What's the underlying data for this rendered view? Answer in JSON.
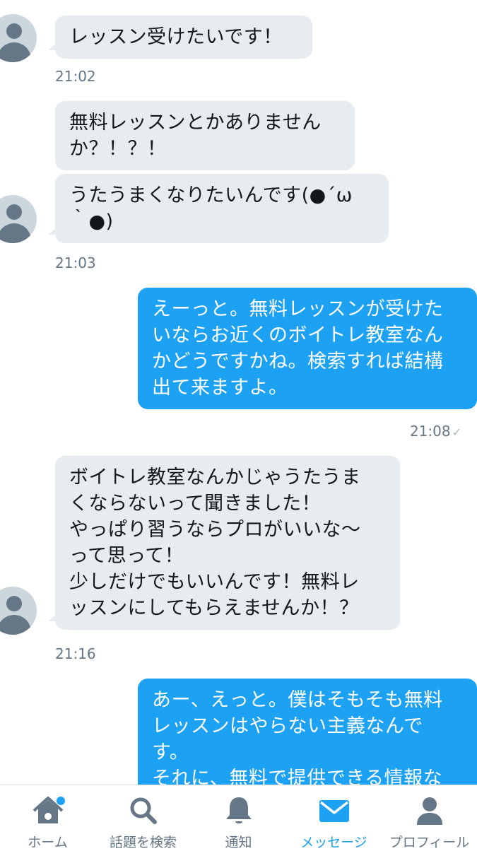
{
  "conversation": {
    "messages": [
      {
        "side": "in",
        "text": "レッスン受けたいです！"
      },
      {
        "side": "in",
        "text": "無料レッスンとかありません\nか？！？！"
      },
      {
        "side": "in",
        "text": "うたうまくなりたいんです(●´ω\n｀●)"
      },
      {
        "side": "out",
        "text": "えーっと。無料レッスンが受けた\nいならお近くのボイトレ教室なん\nかどうですかね。検索すれば結構\n出て来ますよ。"
      },
      {
        "side": "in",
        "text": "ボイトレ教室なんかじゃうたうま\nくならないって聞きました！\nやっぱり習うならプロがいいな〜\nって思って！\n少しだけでもいいんです！無料レ\nッスンにしてもらえませんか！？"
      },
      {
        "side": "out",
        "text": "あー、えっと。僕はそもそも無料\nレッスンはやらない主義なんで\nす。\nそれに、無料で提供できる情報な"
      }
    ],
    "timestamps": [
      "21:02",
      "21:03",
      "21:08",
      "21:16"
    ],
    "read_mark": "✓"
  },
  "tabbar": {
    "items": [
      {
        "label": "ホーム",
        "icon": "home-icon",
        "badge": true
      },
      {
        "label": "話題を検索",
        "icon": "search-icon"
      },
      {
        "label": "通知",
        "icon": "bell-icon"
      },
      {
        "label": "メッセージ",
        "icon": "envelope-icon",
        "active": true
      },
      {
        "label": "プロフィール",
        "icon": "profile-icon"
      }
    ],
    "active_color": "#1da1f2",
    "inactive_color": "#657786"
  },
  "colors": {
    "incoming_bubble": "#e6ecf0",
    "outgoing_bubble": "#1da1f2",
    "timestamp": "#657786"
  }
}
